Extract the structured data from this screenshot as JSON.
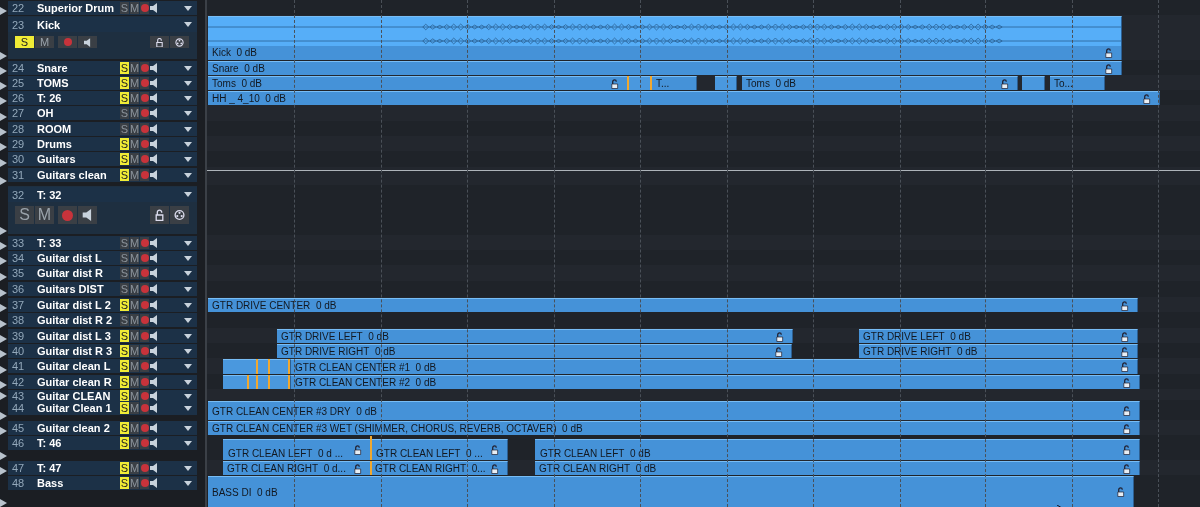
{
  "tracks": [
    {
      "number": "22",
      "name": "Superior Drum",
      "solo_label": "S",
      "mute_label": "M",
      "solo": false,
      "expanded": false
    },
    {
      "number": "23",
      "name": "Kick",
      "solo_label": "S",
      "mute_label": "M",
      "solo": true,
      "expanded": true,
      "clips": [
        {
          "kind": "wave",
          "name": "Kick",
          "gain": "0 dB"
        }
      ]
    },
    {
      "number": "24",
      "name": "Snare",
      "solo_label": "S",
      "mute_label": "M",
      "solo": true,
      "expanded": false,
      "clips": [
        {
          "kind": "audio",
          "name": "Snare",
          "gain": "0 dB"
        }
      ]
    },
    {
      "number": "25",
      "name": "TOMS",
      "solo_label": "S",
      "mute_label": "M",
      "solo": true,
      "expanded": false,
      "clips": [
        {
          "kind": "audio",
          "name": "Toms",
          "gain": "0 dB"
        },
        {
          "kind": "stub"
        },
        {
          "kind": "audio",
          "name": "T..."
        },
        {
          "kind": "stub"
        },
        {
          "kind": "audio",
          "name": "Toms",
          "gain": "0 dB"
        },
        {
          "kind": "stub"
        },
        {
          "kind": "audio",
          "name": "To..."
        }
      ]
    },
    {
      "number": "26",
      "name": "T: 26",
      "solo_label": "S",
      "mute_label": "M",
      "solo": true,
      "expanded": false,
      "clips": [
        {
          "kind": "audio",
          "name": "HH _ 4_10",
          "gain": "0 dB"
        }
      ]
    },
    {
      "number": "27",
      "name": "OH",
      "solo_label": "S",
      "mute_label": "M",
      "solo": false,
      "expanded": false
    },
    {
      "number": "28",
      "name": "ROOM",
      "solo_label": "S",
      "mute_label": "M",
      "solo": false,
      "expanded": false
    },
    {
      "number": "29",
      "name": "Drums",
      "solo_label": "S",
      "mute_label": "M",
      "solo": true,
      "expanded": false
    },
    {
      "number": "30",
      "name": "Guitars",
      "solo_label": "S",
      "mute_label": "M",
      "solo": true,
      "expanded": false
    },
    {
      "number": "31",
      "name": "Guitars clean",
      "solo_label": "S",
      "mute_label": "M",
      "solo": true,
      "expanded": false
    },
    {
      "number": "32",
      "name": "T: 32",
      "solo_label": "S",
      "mute_label": "M",
      "solo": false,
      "expanded": true
    },
    {
      "number": "33",
      "name": "T: 33",
      "solo_label": "S",
      "mute_label": "M",
      "solo": false,
      "expanded": false
    },
    {
      "number": "34",
      "name": "Guitar dist L",
      "solo_label": "S",
      "mute_label": "M",
      "solo": false,
      "expanded": false
    },
    {
      "number": "35",
      "name": "Guitar dist R",
      "solo_label": "S",
      "mute_label": "M",
      "solo": false,
      "expanded": false
    },
    {
      "number": "36",
      "name": "Guitars DIST",
      "solo_label": "S",
      "mute_label": "M",
      "solo": false,
      "expanded": false
    },
    {
      "number": "37",
      "name": "Guitar dist L 2",
      "solo_label": "S",
      "mute_label": "M",
      "solo": true,
      "expanded": false,
      "clips": [
        {
          "kind": "audio",
          "name": "GTR DRIVE CENTER",
          "gain": "0 dB"
        }
      ]
    },
    {
      "number": "38",
      "name": "Guitar dist R 2",
      "solo_label": "S",
      "mute_label": "M",
      "solo": false,
      "expanded": false
    },
    {
      "number": "39",
      "name": "Guitar dist L 3",
      "solo_label": "S",
      "mute_label": "M",
      "solo": true,
      "expanded": false,
      "clips": [
        {
          "kind": "audio",
          "name": "GTR DRIVE LEFT",
          "gain": "0 dB"
        },
        {
          "kind": "audio",
          "name": "GTR DRIVE LEFT",
          "gain": "0 dB"
        }
      ]
    },
    {
      "number": "40",
      "name": "Guitar dist R 3",
      "solo_label": "S",
      "mute_label": "M",
      "solo": true,
      "expanded": false,
      "clips": [
        {
          "kind": "audio",
          "name": "GTR DRIVE RIGHT",
          "gain": "0 dB"
        },
        {
          "kind": "audio",
          "name": "GTR DRIVE RIGHT",
          "gain": "0 dB"
        }
      ]
    },
    {
      "number": "41",
      "name": "Guitar clean L",
      "solo_label": "S",
      "mute_label": "M",
      "solo": true,
      "expanded": false,
      "clips": [
        {
          "kind": "stub"
        },
        {
          "kind": "audio",
          "name": "GTR CLEAN CENTER #1",
          "gain": "0 dB"
        }
      ]
    },
    {
      "number": "42",
      "name": "Guitar clean R",
      "solo_label": "S",
      "mute_label": "M",
      "solo": true,
      "expanded": false,
      "clips": [
        {
          "kind": "stub"
        },
        {
          "kind": "audio",
          "name": "GTR CLEAN CENTER #2",
          "gain": "0 dB"
        }
      ]
    },
    {
      "number": "43",
      "name": "Guitar CLEAN",
      "solo_label": "S",
      "mute_label": "M",
      "solo": true,
      "expanded": false
    },
    {
      "number": "44",
      "name": "Guitar Clean 1",
      "solo_label": "S",
      "mute_label": "M",
      "solo": true,
      "expanded": false,
      "clips": [
        {
          "kind": "audio",
          "name": "GTR CLEAN CENTER #3 DRY",
          "gain": "0 dB"
        }
      ]
    },
    {
      "number": "45",
      "name": "Guitar clean 2",
      "solo_label": "S",
      "mute_label": "M",
      "solo": true,
      "expanded": false,
      "clips": [
        {
          "kind": "audio",
          "name": "GTR CLEAN CENTER #3 WET (SHIMMER, CHORUS, REVERB, OCTAVER)",
          "gain": "0 dB"
        }
      ]
    },
    {
      "number": "46",
      "name": "T: 46",
      "solo_label": "S",
      "mute_label": "M",
      "solo": true,
      "expanded": false,
      "clips": [
        {
          "kind": "audio",
          "name": "GTR CLEAN LEFT",
          "gain": "0 d ..."
        },
        {
          "kind": "audio",
          "name": "GTR CLEAN LEFT",
          "gain": "0 ..."
        },
        {
          "kind": "audio",
          "name": "GTR CLEAN LEFT",
          "gain": "0 dB"
        }
      ]
    },
    {
      "number": "47",
      "name": "T: 47",
      "solo_label": "S",
      "mute_label": "M",
      "solo": true,
      "expanded": false,
      "clips": [
        {
          "kind": "audio",
          "name": "GTR CLEAN RIGHT",
          "gain": "0 d..."
        },
        {
          "kind": "audio",
          "name": "GTR CLEAN RIGHT",
          "gain": "0..."
        },
        {
          "kind": "audio",
          "name": "GTR CLEAN RIGHT",
          "gain": "0 dB"
        }
      ]
    },
    {
      "number": "48",
      "name": "Bass",
      "solo_label": "S",
      "mute_label": "M",
      "solo": true,
      "expanded": false,
      "clips": [
        {
          "kind": "audio",
          "name": "BASS DI",
          "gain": "0 dB"
        }
      ]
    }
  ]
}
